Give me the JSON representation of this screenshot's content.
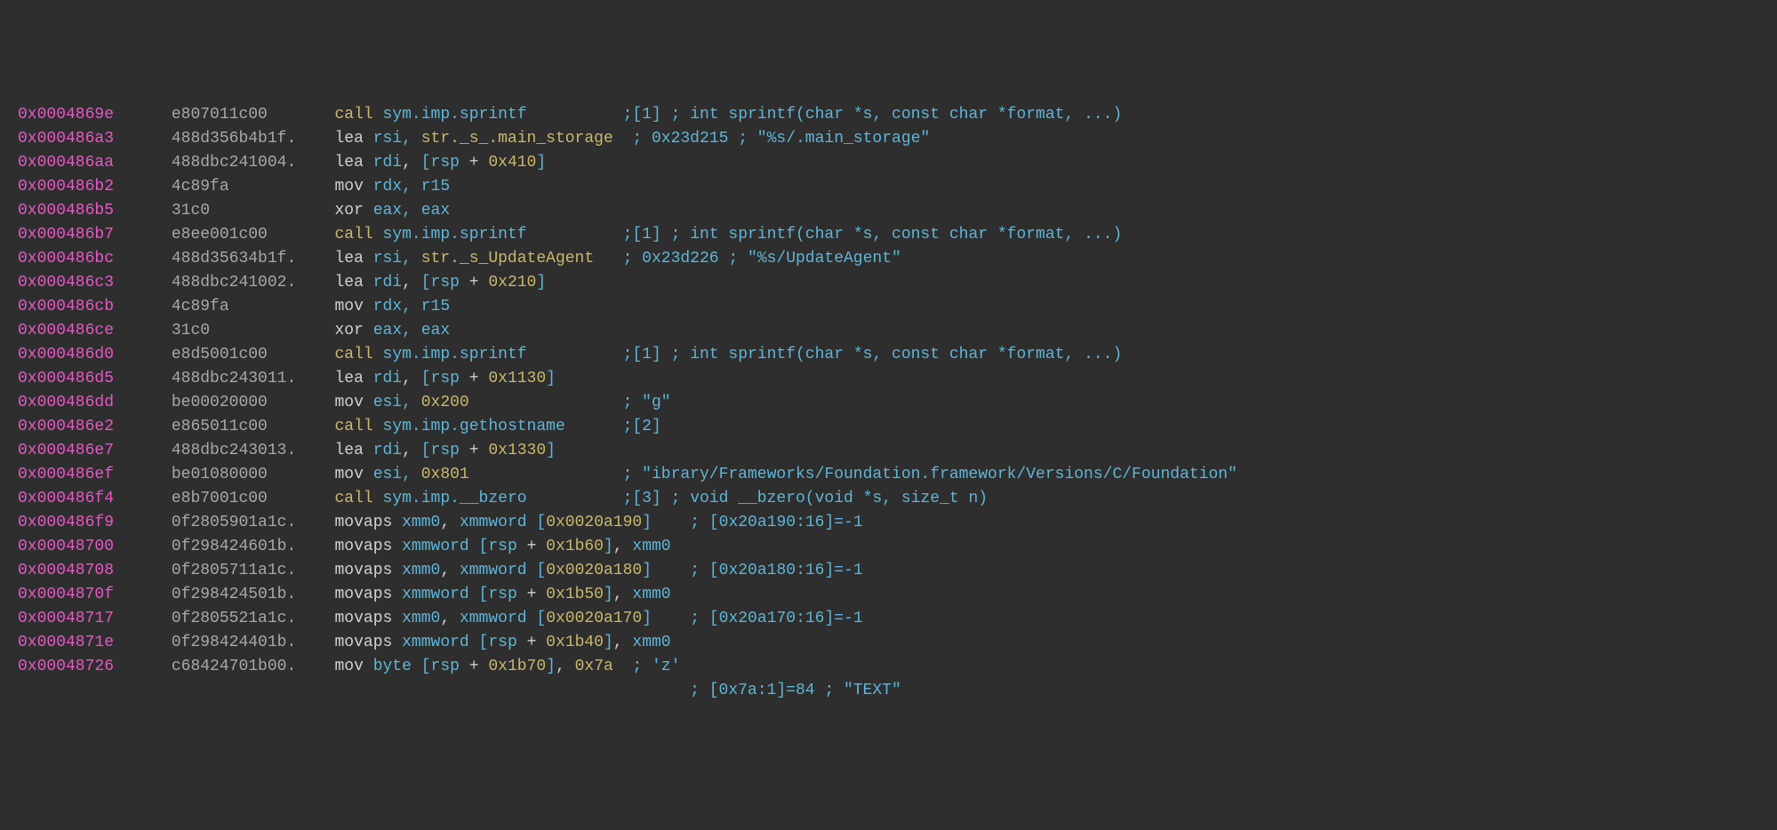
{
  "lines": [
    {
      "addr": "0x0004869e",
      "hex": "e807011c00",
      "op": "call",
      "args": "sym.imp.sprintf",
      "comment": ";[1] ; int sprintf(char *s, const char *format, ...)",
      "argsType": "sym",
      "opType": "call",
      "inset": false
    },
    {
      "addr": "0x000486a3",
      "hex": "488d356b4b1f.",
      "op": "lea",
      "args": "rsi, str._s_.main_storage",
      "comment": "; 0x23d215 ; \"%s/.main_storage\"",
      "argsType": "str",
      "opType": "reg",
      "inset": false
    },
    {
      "addr": "0x000486aa",
      "hex": "488dbc241004.",
      "op": "lea",
      "args": "rdi, [rsp + 0x410]",
      "comment": "",
      "argsType": "mem",
      "opType": "reg",
      "inset": false
    },
    {
      "addr": "0x000486b2",
      "hex": "4c89fa",
      "op": "mov",
      "args": "rdx, r15",
      "comment": "",
      "argsType": "reg",
      "opType": "reg",
      "inset": false
    },
    {
      "addr": "0x000486b5",
      "hex": "31c0",
      "op": "xor",
      "args": "eax, eax",
      "comment": "",
      "argsType": "reg",
      "opType": "reg",
      "inset": false
    },
    {
      "addr": "0x000486b7",
      "hex": "e8ee001c00",
      "op": "call",
      "args": "sym.imp.sprintf",
      "comment": ";[1] ; int sprintf(char *s, const char *format, ...)",
      "argsType": "sym",
      "opType": "call",
      "inset": false
    },
    {
      "addr": "0x000486bc",
      "hex": "488d35634b1f.",
      "op": "lea",
      "args": "rsi, str._s_UpdateAgent",
      "comment": "; 0x23d226 ; \"%s/UpdateAgent\"",
      "argsType": "str",
      "opType": "reg",
      "inset": false
    },
    {
      "addr": "0x000486c3",
      "hex": "488dbc241002.",
      "op": "lea",
      "args": "rdi, [rsp + 0x210]",
      "comment": "",
      "argsType": "mem",
      "opType": "reg",
      "inset": false
    },
    {
      "addr": "0x000486cb",
      "hex": "4c89fa",
      "op": "mov",
      "args": "rdx, r15",
      "comment": "",
      "argsType": "reg",
      "opType": "reg",
      "inset": false
    },
    {
      "addr": "0x000486ce",
      "hex": "31c0",
      "op": "xor",
      "args": "eax, eax",
      "comment": "",
      "argsType": "reg",
      "opType": "reg",
      "inset": false
    },
    {
      "addr": "0x000486d0",
      "hex": "e8d5001c00",
      "op": "call",
      "args": "sym.imp.sprintf",
      "comment": ";[1] ; int sprintf(char *s, const char *format, ...)",
      "argsType": "sym",
      "opType": "call",
      "inset": false
    },
    {
      "addr": "0x000486d5",
      "hex": "488dbc243011.",
      "op": "lea",
      "args": "rdi, [rsp + 0x1130]",
      "comment": "",
      "argsType": "mem",
      "opType": "reg",
      "inset": false
    },
    {
      "addr": "0x000486dd",
      "hex": "be00020000",
      "op": "mov",
      "args": "esi, 0x200",
      "comment": "; \"g\"",
      "argsType": "num",
      "opType": "reg",
      "inset": false
    },
    {
      "addr": "0x000486e2",
      "hex": "e865011c00",
      "op": "call",
      "args": "sym.imp.gethostname",
      "comment": ";[2]",
      "argsType": "sym",
      "opType": "call",
      "inset": false
    },
    {
      "addr": "0x000486e7",
      "hex": "488dbc243013.",
      "op": "lea",
      "args": "rdi, [rsp + 0x1330]",
      "comment": "",
      "argsType": "mem",
      "opType": "reg",
      "inset": false
    },
    {
      "addr": "0x000486ef",
      "hex": "be01080000",
      "op": "mov",
      "args": "esi, 0x801",
      "comment": "; \"ibrary/Frameworks/Foundation.framework/Versions/C/Foundation\"",
      "argsType": "num",
      "opType": "reg",
      "inset": false
    },
    {
      "addr": "0x000486f4",
      "hex": "e8b7001c00",
      "op": "call",
      "args": "sym.imp.__bzero",
      "comment": ";[3] ; void __bzero(void *s, size_t n)",
      "argsType": "sym",
      "opType": "call",
      "inset": false
    },
    {
      "addr": "0x000486f9",
      "hex": "0f2805901a1c.",
      "op": "movaps",
      "args": "xmm0, xmmword [0x0020a190]",
      "comment": "; [0x20a190:16]=-1",
      "argsType": "mem",
      "opType": "reg",
      "inset": true
    },
    {
      "addr": "0x00048700",
      "hex": "0f298424601b.",
      "op": "movaps",
      "args": "xmmword [rsp + 0x1b60], xmm0",
      "comment": "",
      "argsType": "mem",
      "opType": "reg",
      "inset": false
    },
    {
      "addr": "0x00048708",
      "hex": "0f2805711a1c.",
      "op": "movaps",
      "args": "xmm0, xmmword [0x0020a180]",
      "comment": "; [0x20a180:16]=-1",
      "argsType": "mem",
      "opType": "reg",
      "inset": true
    },
    {
      "addr": "0x0004870f",
      "hex": "0f298424501b.",
      "op": "movaps",
      "args": "xmmword [rsp + 0x1b50], xmm0",
      "comment": "",
      "argsType": "mem",
      "opType": "reg",
      "inset": false
    },
    {
      "addr": "0x00048717",
      "hex": "0f2805521a1c.",
      "op": "movaps",
      "args": "xmm0, xmmword [0x0020a170]",
      "comment": "; [0x20a170:16]=-1",
      "argsType": "mem",
      "opType": "reg",
      "inset": true
    },
    {
      "addr": "0x0004871e",
      "hex": "0f298424401b.",
      "op": "movaps",
      "args": "xmmword [rsp + 0x1b40], xmm0",
      "comment": "",
      "argsType": "mem",
      "opType": "reg",
      "inset": false
    },
    {
      "addr": "0x00048726",
      "hex": "c68424701b00.",
      "op": "mov",
      "args": "byte [rsp + 0x1b70], 0x7a",
      "comment": "; 'z'",
      "argsType": "mem",
      "opType": "reg",
      "inset": false
    }
  ],
  "trailing_comment": "; [0x7a:1]=84 ; \"TEXT\""
}
